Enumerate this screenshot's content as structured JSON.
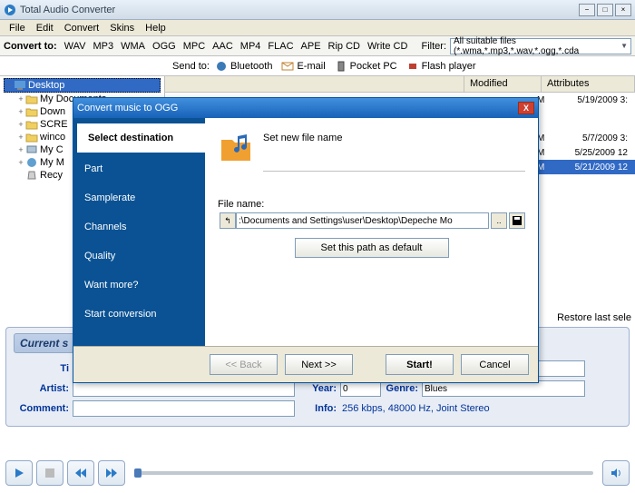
{
  "window": {
    "title": "Total Audio Converter"
  },
  "menu": {
    "file": "File",
    "edit": "Edit",
    "convert": "Convert",
    "skins": "Skins",
    "help": "Help"
  },
  "convert": {
    "label": "Convert to:",
    "formats": [
      "WAV",
      "MP3",
      "WMA",
      "OGG",
      "MPC",
      "AAC",
      "MP4",
      "FLAC",
      "APE",
      "Rip CD",
      "Write CD"
    ],
    "filter_label": "Filter:",
    "filter_value": "All suitable files (*.wma,*.mp3,*.wav,*.ogg,*.cda"
  },
  "send": {
    "label": "Send to:",
    "items": [
      "Bluetooth",
      "E-mail",
      "Pocket PC",
      "Flash player"
    ]
  },
  "tree": {
    "root": "Desktop",
    "children": [
      "My Documents",
      "Down",
      "SCRE",
      "winco",
      "My C",
      "My M",
      "Recy"
    ]
  },
  "filelist": {
    "cols": {
      "modified": "Modified",
      "attr": "Attributes"
    },
    "rows": [
      {
        "m": "M",
        "date": "5/19/2009 3:"
      },
      {
        "m": "M",
        "date": "5/7/2009 3:"
      },
      {
        "m": "M",
        "date": "5/25/2009 12"
      },
      {
        "m": "M",
        "date": "5/21/2009 12",
        "sel": true
      }
    ]
  },
  "restore": "Restore last sele",
  "info": {
    "current": "Current s",
    "title_lbl": "Ti",
    "artist_lbl": "Artist:",
    "comment_lbl": "Comment:",
    "year_lbl": "Year:",
    "year_val": "0",
    "genre_lbl": "Genre:",
    "genre_val": "Blues",
    "info_lbl": "Info:",
    "info_val": "256 kbps, 48000 Hz, Joint Stereo"
  },
  "dialog": {
    "title": "Convert music to OGG",
    "steps": [
      "Select destination",
      "Part",
      "Samplerate",
      "Channels",
      "Quality",
      "Want more?",
      "Start conversion"
    ],
    "active_step": 0,
    "heading": "Set new file name",
    "fn_label": "File name:",
    "fn_value": ":\\Documents and Settings\\user\\Desktop\\Depeche Mo",
    "set_path": "Set this path as default",
    "back": "<< Back",
    "next": "Next >>",
    "start": "Start!",
    "cancel": "Cancel"
  }
}
